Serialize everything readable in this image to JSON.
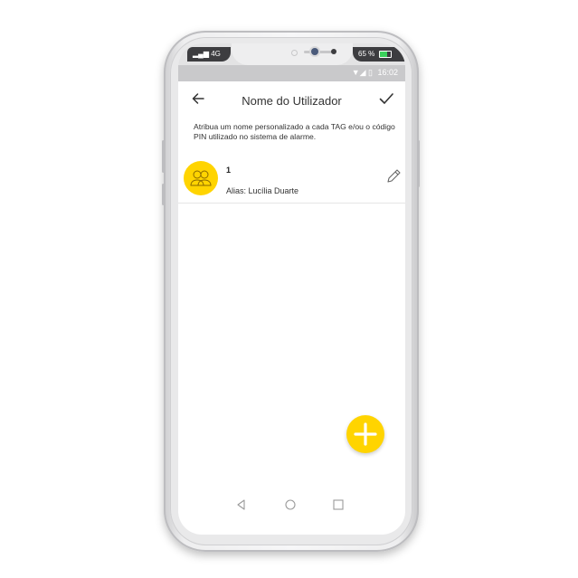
{
  "status": {
    "carrier": "4G",
    "battery_percent": "65 %",
    "time": "16:02"
  },
  "appbar": {
    "title": "Nome do Utilizador"
  },
  "description": "Atribua um nome personalizado a cada TAG e/ou o código PIN utilizado no sistema de alarme.",
  "users": [
    {
      "number": "1",
      "alias": "Alias: Lucília Duarte"
    }
  ],
  "colors": {
    "accent": "#ffd400",
    "text": "#333333",
    "divider": "#e6e6e6"
  },
  "icons": {
    "back": "arrow-left-icon",
    "confirm": "check-icon",
    "avatar": "users-icon",
    "edit": "pencil-icon",
    "add": "plus-icon",
    "nav_back": "triangle-back-icon",
    "nav_home": "circle-home-icon",
    "nav_recent": "square-recent-icon"
  }
}
